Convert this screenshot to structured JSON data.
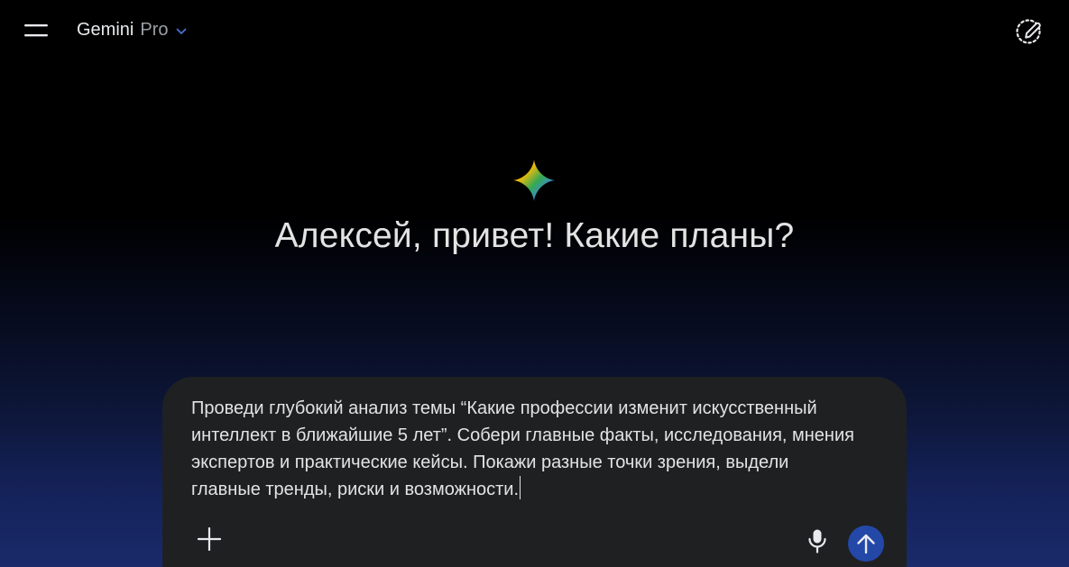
{
  "header": {
    "app_name": "Gemini",
    "model_tier": "Pro",
    "menu_icon": "hamburger-menu-icon",
    "model_dropdown_icon": "chevron-down-icon",
    "new_chat_icon": "new-chat-icon"
  },
  "main": {
    "logo_icon": "gemini-spark-icon",
    "greeting": "Алексей, привет! Какие планы?"
  },
  "composer": {
    "prompt_text": "Проведи глубокий анализ темы “Какие профессии изменит искусственный интеллект в ближайшие 5 лет”. Собери главные факты, исследования, мнения экспертов и практические кейсы. Покажи разные точки зрения, выдели главные тренды, риски и возможности.",
    "add_icon": "plus-icon",
    "mic_icon": "microphone-icon",
    "send_icon": "arrow-up-icon"
  },
  "colors": {
    "background_top": "#000000",
    "background_bottom": "#1a2a6a",
    "composer_bg": "#1f2022",
    "text_primary": "#e3e3e3",
    "text_secondary": "#9aa0a6",
    "dropdown_accent": "#4a6fd4",
    "send_button_bg": "#2348a8"
  }
}
